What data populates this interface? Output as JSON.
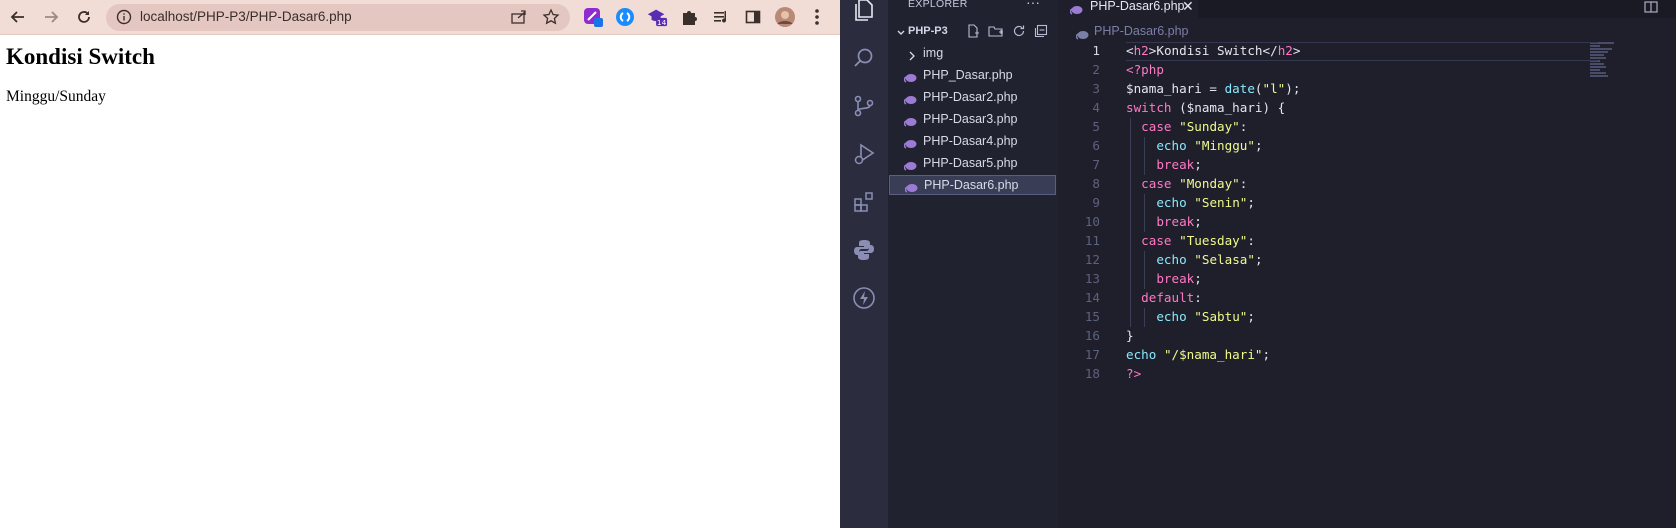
{
  "browser": {
    "url_host": "localhost",
    "url_path": "/PHP-P3/PHP-Dasar6.php",
    "extension_badge": "14",
    "page_heading": "Kondisi Switch",
    "page_output": "Minggu/Sunday"
  },
  "explorer": {
    "title": "EXPLORER",
    "more": "···",
    "project": "PHP-P3",
    "items": [
      {
        "label": "img"
      },
      {
        "label": "PHP_Dasar.php"
      },
      {
        "label": "PHP-Dasar2.php"
      },
      {
        "label": "PHP-Dasar3.php"
      },
      {
        "label": "PHP-Dasar4.php"
      },
      {
        "label": "PHP-Dasar5.php"
      },
      {
        "label": "PHP-Dasar6.php"
      }
    ]
  },
  "editor": {
    "tab_label": "PHP-Dasar6.php",
    "breadcrumb": "PHP-Dasar6.php",
    "line_numbers": [
      "1",
      "2",
      "3",
      "4",
      "5",
      "6",
      "7",
      "8",
      "9",
      "10",
      "11",
      "12",
      "13",
      "14",
      "15",
      "16",
      "17",
      "18"
    ],
    "code": {
      "l1_text": "Kondisi Switch",
      "h2_open": "h2",
      "h2_close": "h2",
      "php_open": "<?php",
      "var": "$nama_hari",
      "assign": " = ",
      "date_fn": "date",
      "date_arg": "\"l\"",
      "switch_kw": "switch",
      "switch_arg": " ($nama_hari) {",
      "case": "case",
      "echo": "echo",
      "break": "break",
      "default": "default",
      "sunday": "\"Sunday\"",
      "monday": "\"Monday\"",
      "tuesday": "\"Tuesday\"",
      "minggu": "\"Minggu\"",
      "senin": "\"Senin\"",
      "selasa": "\"Selasa\"",
      "sabtu": "\"Sabtu\"",
      "close_brace": "}",
      "final_echo": "\"/$nama_hari\"",
      "php_close": "?>"
    }
  },
  "colors": {
    "browser_toolbar": "#f1dcd6",
    "vscode_bg": "#1e1f2b",
    "keyword": "#ff79c6",
    "string": "#f1fa8c",
    "function": "#8be9fd"
  }
}
